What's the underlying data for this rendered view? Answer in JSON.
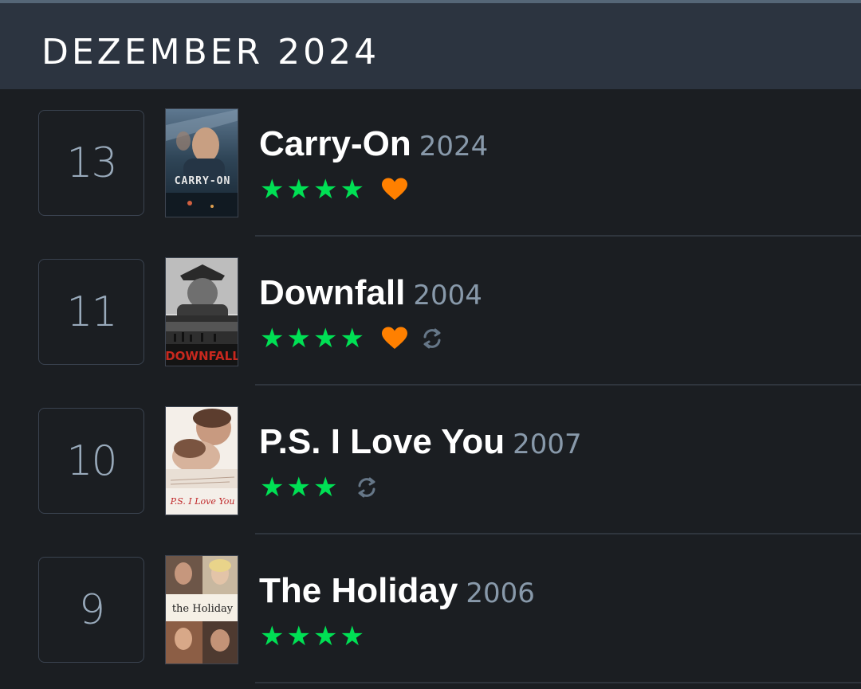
{
  "header": {
    "title": "DEZEMBER 2024"
  },
  "entries": [
    {
      "day": "13",
      "title": "Carry-On",
      "year": "2024",
      "rating_stars": 4,
      "stars": "★★★★",
      "liked": true,
      "rewatch": false,
      "poster_text": "CARRY-ON"
    },
    {
      "day": "11",
      "title": "Downfall",
      "year": "2004",
      "rating_stars": 4,
      "stars": "★★★★",
      "liked": true,
      "rewatch": true,
      "poster_text": "DOWNFALL"
    },
    {
      "day": "10",
      "title": "P.S. I Love You",
      "year": "2007",
      "rating_stars": 3,
      "stars": "★★★",
      "liked": false,
      "rewatch": true,
      "poster_text": "P.S. I Love You"
    },
    {
      "day": "9",
      "title": "The Holiday",
      "year": "2006",
      "rating_stars": 4,
      "stars": "★★★★",
      "liked": false,
      "rewatch": false,
      "poster_text": "the Holiday"
    }
  ],
  "colors": {
    "star": "#00e054",
    "heart": "#ff8000",
    "rewatch": "#667788",
    "header_bg": "#2c3440",
    "list_bg": "#1b1e22"
  },
  "icons": {
    "heart": "heart-icon",
    "rewatch": "rewatch-icon",
    "star": "star-icon"
  }
}
